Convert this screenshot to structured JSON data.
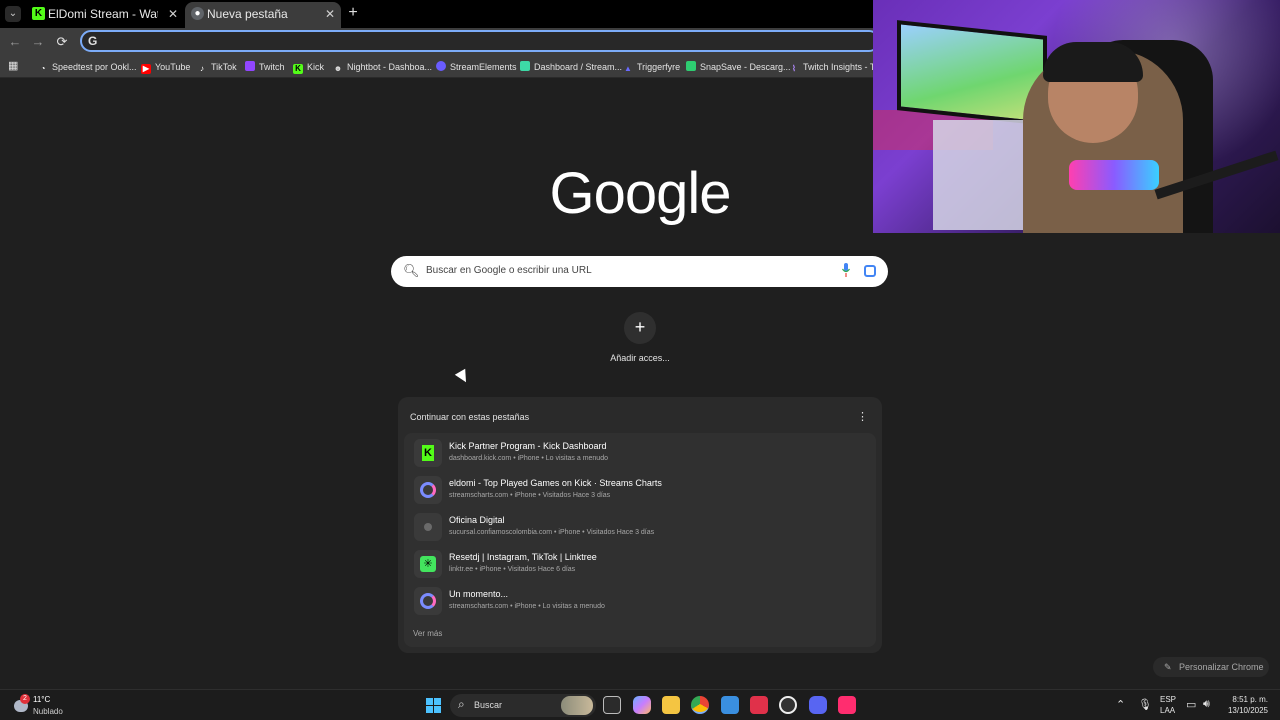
{
  "tabs": [
    {
      "title": "ElDomi Stream - Watch Live on Kick",
      "favicon_color": "#53fc18",
      "active": false
    },
    {
      "title": "Nueva pestaña",
      "favicon_color": "#8ab4f8",
      "active": true
    }
  ],
  "toolbar": {
    "back": "←",
    "forward": "→",
    "reload": "⟳",
    "omnibox_icon": "G"
  },
  "bookmarks": [
    {
      "label": "Speedtest por Ookl...",
      "icon": "◔",
      "color": "#ffffff"
    },
    {
      "label": "YouTube",
      "icon": "▶",
      "color": "#ff0000"
    },
    {
      "label": "TikTok",
      "icon": "♪",
      "color": "#000000"
    },
    {
      "label": "Twitch",
      "icon": "▮",
      "color": "#9146ff"
    },
    {
      "label": "Kick",
      "icon": "K",
      "color": "#53fc18"
    },
    {
      "label": "Nightbot - Dashboa...",
      "icon": "☻",
      "color": "#cccccc"
    },
    {
      "label": "StreamElements",
      "icon": "◗",
      "color": "#6a5cff"
    },
    {
      "label": "Dashboard / Stream...",
      "icon": "▣",
      "color": "#3dd9a6"
    },
    {
      "label": "Triggerfyre",
      "icon": "▲",
      "color": "#6a6aff"
    },
    {
      "label": "SnapSave - Descarg...",
      "icon": "⇩",
      "color": "#2ecc71"
    },
    {
      "label": "Twitch Insights - Te",
      "icon": "⌇",
      "color": "#9146ff"
    }
  ],
  "ntp": {
    "logo": "Google",
    "search_placeholder": "Buscar en Google o escribir una URL",
    "add_shortcut_label": "Añadir acces...",
    "add_shortcut_icon": "+",
    "continue_header": "Continuar con estas pestañas",
    "more_icon": "⋮",
    "items": [
      {
        "title": "Kick Partner Program - Kick Dashboard",
        "subtitle": "dashboard.kick.com • iPhone • Lo visitas a menudo",
        "icon": "kick-icon",
        "icon_color": "#53fc18"
      },
      {
        "title": "eldomi - Top Played Games on Kick · Streams Charts",
        "subtitle": "streamscharts.com • iPhone • Visitados Hace 3 días",
        "icon": "streamscharts-icon",
        "icon_color": "#7b8cff"
      },
      {
        "title": "Oficina Digital",
        "subtitle": "sucursal.confiamoscolombia.com • iPhone • Visitados Hace 3 días",
        "icon": "globe-icon",
        "icon_color": "#6a6a6a"
      },
      {
        "title": "Resetdj | Instagram, TikTok | Linktree",
        "subtitle": "linktr.ee • iPhone • Visitados Hace 6 días",
        "icon": "linktree-icon",
        "icon_color": "#43e55e"
      },
      {
        "title": "Un momento...",
        "subtitle": "streamscharts.com • iPhone • Lo visitas a menudo",
        "icon": "streamscharts-icon",
        "icon_color": "#7b8cff"
      }
    ],
    "see_more": "Ver más",
    "customize": "Personalizar Chrome"
  },
  "taskbar": {
    "weather_temp": "11°C",
    "weather_cond": "Nublado",
    "weather_badge": "2",
    "search_label": "Buscar",
    "lang_top": "ESP",
    "lang_bottom": "LAA",
    "time": "8:51 p. m.",
    "date": "13/10/2025",
    "pinned": [
      {
        "name": "task-view-icon",
        "color": "#d0d0d0"
      },
      {
        "name": "copilot-icon",
        "color": "#6ab0ff"
      },
      {
        "name": "file-explorer-icon",
        "color": "#f4c542"
      },
      {
        "name": "chrome-icon",
        "color": "#34a853"
      },
      {
        "name": "store-icon",
        "color": "#3a8fe0"
      },
      {
        "name": "capcut-icon",
        "color": "#e0314a"
      },
      {
        "name": "obs-icon",
        "color": "#eeeeee"
      },
      {
        "name": "discord-icon",
        "color": "#5865f2"
      },
      {
        "name": "tiktok-app-icon",
        "color": "#ff2d6f"
      }
    ]
  }
}
